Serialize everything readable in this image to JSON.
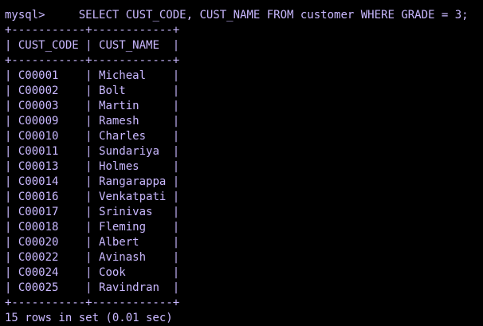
{
  "terminal": {
    "prompt": "mysql>",
    "command": "SELECT CUST_CODE, CUST_NAME FROM customer WHERE GRADE = 3;",
    "border": "+-----------+------------+",
    "columns": [
      "CUST_CODE",
      "CUST_NAME"
    ],
    "rows": [
      [
        "C00001",
        "Micheal"
      ],
      [
        "C00002",
        "Bolt"
      ],
      [
        "C00003",
        "Martin"
      ],
      [
        "C00009",
        "Ramesh"
      ],
      [
        "C00010",
        "Charles"
      ],
      [
        "C00011",
        "Sundariya"
      ],
      [
        "C00013",
        "Holmes"
      ],
      [
        "C00014",
        "Rangarappa"
      ],
      [
        "C00016",
        "Venkatpati"
      ],
      [
        "C00017",
        "Srinivas"
      ],
      [
        "C00018",
        "Fleming"
      ],
      [
        "C00020",
        "Albert"
      ],
      [
        "C00022",
        "Avinash"
      ],
      [
        "C00024",
        "Cook"
      ],
      [
        "C00025",
        "Ravindran"
      ]
    ],
    "result_summary": "15 rows in set (0.01 sec)"
  },
  "colors": {
    "background": "#000000",
    "text": "#c9b8ff"
  }
}
